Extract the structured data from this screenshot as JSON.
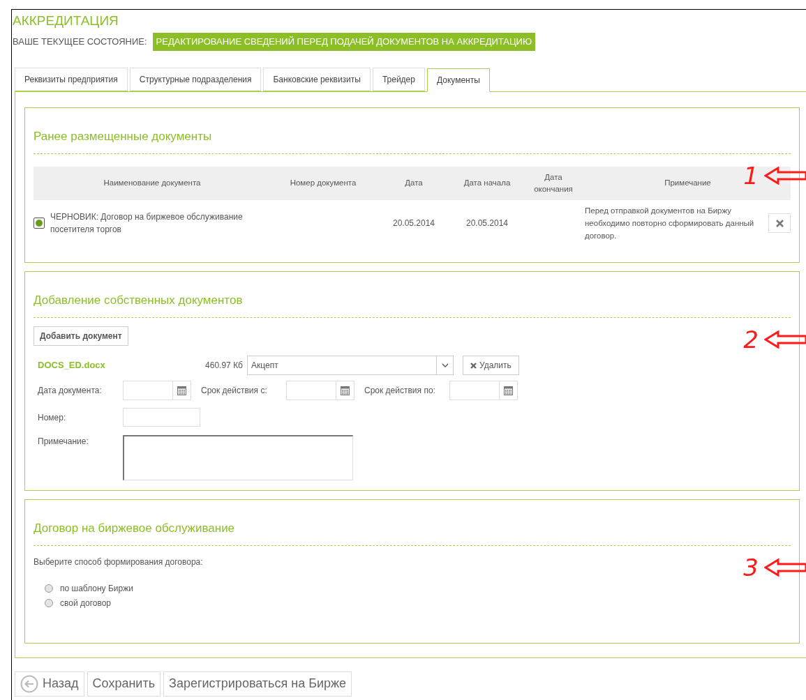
{
  "header": {
    "title": "АККРЕДИТАЦИЯ",
    "state_label": "ВАШЕ ТЕКУЩЕЕ СОСТОЯНИЕ:",
    "state_value": "РЕДАКТИРОВАНИЕ СВЕДЕНИЙ ПЕРЕД ПОДАЧЕЙ ДОКУМЕНТОВ НА АККРЕДИТАЦИЮ"
  },
  "tabs": [
    {
      "label": "Реквизиты предприятия",
      "selected": false
    },
    {
      "label": "Структурные подразделения",
      "selected": false
    },
    {
      "label": "Банковские реквизиты",
      "selected": false
    },
    {
      "label": "Трейдер",
      "selected": false
    },
    {
      "label": "Документы",
      "selected": true
    }
  ],
  "previous_documents": {
    "title": "Ранее размещенные документы",
    "annotation": "1",
    "columns": [
      "Наименование документа",
      "Номер документа",
      "Дата",
      "Дата начала",
      "Дата окончания",
      "Примечание"
    ],
    "rows": [
      {
        "name": "ЧЕРНОВИК: Договор на биржевое обслуживание посетителя торгов",
        "date": "20.05.2014",
        "start_date": "20.05.2014",
        "note": "Перед отправкой документов на Биржу необходимо повторно сформировать данный договор."
      }
    ]
  },
  "own_documents": {
    "title": "Добавление собственных документов",
    "annotation": "2",
    "add_button": "Добавить документ",
    "file": {
      "name": "DOCS_ED.docx",
      "size": "460.97 Кб",
      "type": "Акцепт",
      "delete_button": "Удалить"
    },
    "date_fields": [
      {
        "label": "Дата документа:"
      },
      {
        "label": "Срок действия с:"
      },
      {
        "label": "Срок действия по:"
      }
    ],
    "number_label": "Номер:",
    "note_label": "Примечание:"
  },
  "contract": {
    "title": "Договор на биржевое обслуживание",
    "annotation": "3",
    "prompt": "Выберите способ формирования договора:",
    "options": [
      {
        "label": "по шаблону Биржи",
        "selected": false
      },
      {
        "label": "свой договор",
        "selected": false
      }
    ]
  },
  "buttons": [
    {
      "label": "Назад",
      "kind": "back"
    },
    {
      "label": "Сохранить",
      "kind": "plain"
    },
    {
      "label": "Зарегистрироваться на Бирже",
      "kind": "plain"
    }
  ]
}
